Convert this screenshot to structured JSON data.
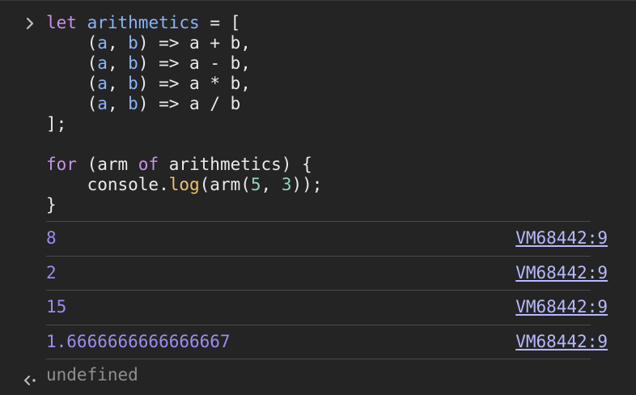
{
  "input": {
    "lines": [
      {
        "parts": [
          {
            "text": "let",
            "cls": "kw"
          },
          {
            "text": " ",
            "cls": "plain"
          },
          {
            "text": "arithmetics",
            "cls": "id"
          },
          {
            "text": " = [",
            "cls": "plain"
          }
        ]
      },
      {
        "parts": [
          {
            "text": "    (",
            "cls": "plain"
          },
          {
            "text": "a",
            "cls": "id"
          },
          {
            "text": ", ",
            "cls": "plain"
          },
          {
            "text": "b",
            "cls": "id"
          },
          {
            "text": ") => a + b,",
            "cls": "plain"
          }
        ]
      },
      {
        "parts": [
          {
            "text": "    (",
            "cls": "plain"
          },
          {
            "text": "a",
            "cls": "id"
          },
          {
            "text": ", ",
            "cls": "plain"
          },
          {
            "text": "b",
            "cls": "id"
          },
          {
            "text": ") => a - b,",
            "cls": "plain"
          }
        ]
      },
      {
        "parts": [
          {
            "text": "    (",
            "cls": "plain"
          },
          {
            "text": "a",
            "cls": "id"
          },
          {
            "text": ", ",
            "cls": "plain"
          },
          {
            "text": "b",
            "cls": "id"
          },
          {
            "text": ") => a * b,",
            "cls": "plain"
          }
        ]
      },
      {
        "parts": [
          {
            "text": "    (",
            "cls": "plain"
          },
          {
            "text": "a",
            "cls": "id"
          },
          {
            "text": ", ",
            "cls": "plain"
          },
          {
            "text": "b",
            "cls": "id"
          },
          {
            "text": ") => a / b",
            "cls": "plain"
          }
        ]
      },
      {
        "parts": [
          {
            "text": "];",
            "cls": "plain"
          }
        ]
      },
      {
        "parts": [
          {
            "text": "",
            "cls": "plain"
          }
        ]
      },
      {
        "parts": [
          {
            "text": "for",
            "cls": "kw"
          },
          {
            "text": " (arm ",
            "cls": "plain"
          },
          {
            "text": "of",
            "cls": "kw"
          },
          {
            "text": " arithmetics) {",
            "cls": "plain"
          }
        ]
      },
      {
        "parts": [
          {
            "text": "    console.",
            "cls": "plain"
          },
          {
            "text": "log",
            "cls": "fn"
          },
          {
            "text": "(arm(",
            "cls": "plain"
          },
          {
            "text": "5",
            "cls": "num"
          },
          {
            "text": ", ",
            "cls": "plain"
          },
          {
            "text": "3",
            "cls": "num"
          },
          {
            "text": "));",
            "cls": "plain"
          }
        ]
      },
      {
        "parts": [
          {
            "text": "}",
            "cls": "plain"
          }
        ]
      }
    ]
  },
  "outputs": [
    {
      "value": "8",
      "source": "VM68442:9"
    },
    {
      "value": "2",
      "source": "VM68442:9"
    },
    {
      "value": "15",
      "source": "VM68442:9"
    },
    {
      "value": "1.6666666666666667",
      "source": "VM68442:9"
    }
  ],
  "result": {
    "text": "undefined"
  },
  "colors": {
    "background": "#242424",
    "keyword": "#c792ea",
    "identifier": "#8ab4f8",
    "function": "#f2c26a",
    "number": "#8fd3c1",
    "log_output": "#9d8cf0",
    "source_link": "#b7b9ff",
    "result_text": "#8f8f8f"
  },
  "icons": {
    "prompt": "chevron-right-icon",
    "result": "chevron-left-dot-icon"
  }
}
